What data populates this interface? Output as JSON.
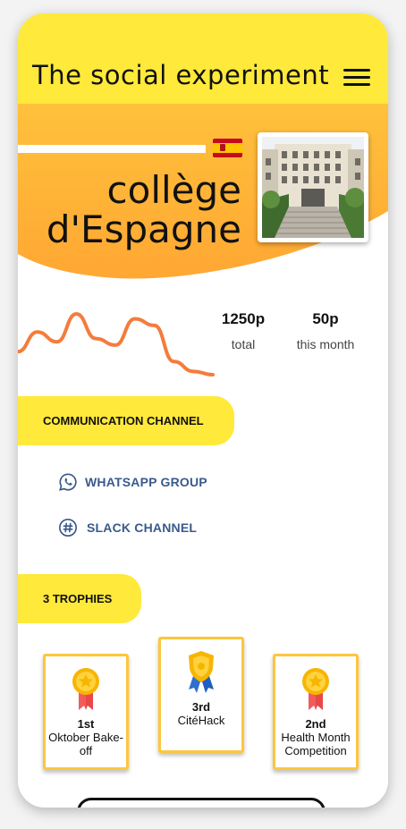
{
  "app": {
    "brand": "The social experiment"
  },
  "colors": {
    "accent_yellow": "#ffe93a",
    "hero_orange": "#ffa733",
    "sparkline": "#f47c3c",
    "link_blue": "#3a5a8c",
    "trophy_border": "#fdc63c"
  },
  "header": {
    "menu_icon": "hamburger-icon"
  },
  "hero": {
    "name_line1": "collège",
    "name_line2": "d'Espagne",
    "flag_icon": "spain-flag-icon",
    "photo": "college-building-photo"
  },
  "stats": {
    "sparkline_values": [
      22,
      34,
      28,
      45,
      30,
      26,
      42,
      38,
      16,
      10,
      8
    ],
    "items": [
      {
        "value": "1250p",
        "label": "total"
      },
      {
        "value": "50p",
        "label": "this month"
      }
    ]
  },
  "communication": {
    "title": "COMMUNICATION CHANNEL",
    "channels": [
      {
        "label": "WHATSAPP GROUP",
        "icon": "whatsapp-icon"
      },
      {
        "label": "SLACK CHANNEL",
        "icon": "slack-icon"
      }
    ]
  },
  "trophies": {
    "title": "3 TROPHIES",
    "items": [
      {
        "rank": "1st",
        "name": "Oktober Bake-off",
        "medal": "gold-medal-icon"
      },
      {
        "rank": "3rd",
        "name": "CitéHack",
        "medal": "gold-shield-blue-ribbon-icon"
      },
      {
        "rank": "2nd",
        "name": "Health Month Competition",
        "medal": "gold-medal-icon"
      }
    ]
  }
}
